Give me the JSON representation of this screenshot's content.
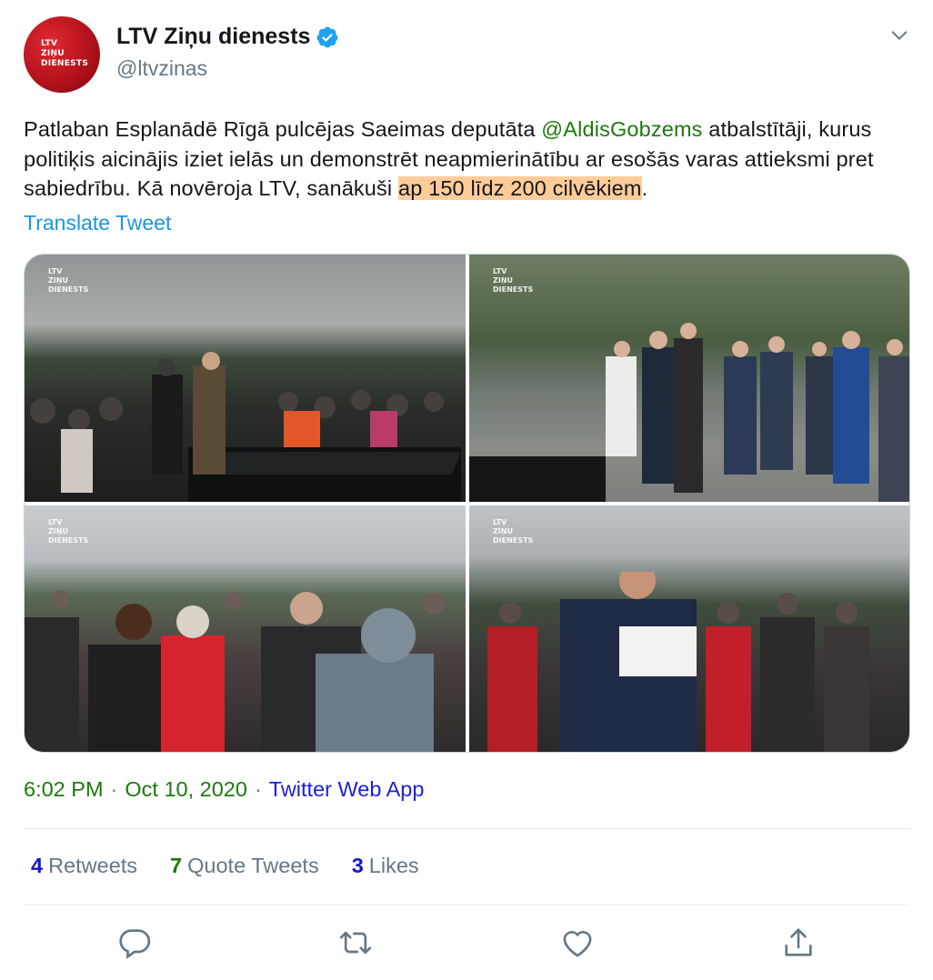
{
  "author": {
    "display_name": "LTV Ziņu dienests",
    "handle": "@ltvzinas",
    "verified_icon": "verified-badge-icon",
    "avatar_text": [
      "LTV",
      "ZIŅU",
      "DIENESTS"
    ]
  },
  "tweet": {
    "text_before_mention": "Patlaban Esplanādē Rīgā pulcējas Saeimas deputāta ",
    "mention": "@AldisGobzems",
    "text_after_mention": " atbalstītāji, kurus politiķis aicinājis iziet ielās un demonstrēt neapmierinātību ar esošās varas attieksmi pret sabiedrību. Kā novēroja LTV, sanākuši ",
    "highlighted": "ap 150 līdz 200 cilvēkiem",
    "text_end": ".",
    "translate_label": "Translate Tweet"
  },
  "media": {
    "watermark": [
      "LTV",
      "ZIŅU",
      "DIENESTS"
    ]
  },
  "meta": {
    "time": "6:02 PM",
    "separator": "·",
    "date": "Oct 10, 2020",
    "source": "Twitter Web App"
  },
  "stats": {
    "retweets_count": "4",
    "retweets_label": "Retweets",
    "quotes_count": "7",
    "quotes_label": "Quote Tweets",
    "likes_count": "3",
    "likes_label": "Likes"
  },
  "colors": {
    "mention_green": "#1b7a0b",
    "link_blue": "#1b95e0",
    "highlight": "#ffcc99",
    "avatar_red": "#b5121b"
  },
  "actions": [
    "reply-icon",
    "retweet-icon",
    "like-icon",
    "share-icon"
  ]
}
